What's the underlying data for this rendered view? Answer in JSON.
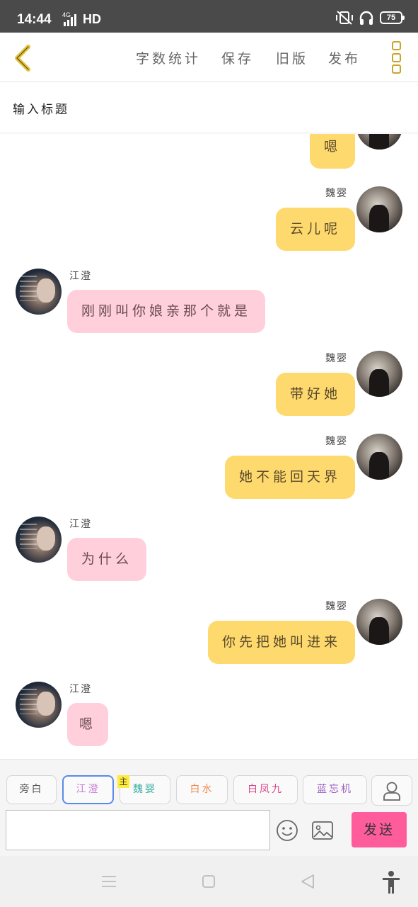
{
  "status": {
    "time": "14:44",
    "network": "4G",
    "hd": "HD",
    "battery": "75"
  },
  "toolbar": {
    "word_count": "字数统计",
    "save": "保存",
    "old_version": "旧版",
    "publish": "发布"
  },
  "title_field": {
    "placeholder": "输入标题"
  },
  "messages": [
    {
      "side": "right",
      "speaker": "",
      "text": "嗯",
      "color": "yellow"
    },
    {
      "side": "right",
      "speaker": "魏婴",
      "text": "云儿呢",
      "color": "yellow"
    },
    {
      "side": "left",
      "speaker": "江澄",
      "text": "刚刚叫你娘亲那个就是",
      "color": "pink"
    },
    {
      "side": "right",
      "speaker": "魏婴",
      "text": "带好她",
      "color": "yellow"
    },
    {
      "side": "right",
      "speaker": "魏婴",
      "text": "她不能回天界",
      "color": "yellow"
    },
    {
      "side": "left",
      "speaker": "江澄",
      "text": "为什么",
      "color": "pink"
    },
    {
      "side": "right",
      "speaker": "魏婴",
      "text": "你先把她叫进来",
      "color": "yellow"
    },
    {
      "side": "left",
      "speaker": "江澄",
      "text": "嗯",
      "color": "pink"
    }
  ],
  "roles": [
    {
      "label": "旁白",
      "color": "#555555"
    },
    {
      "label": "江澄",
      "color": "#c77dd6"
    },
    {
      "label": "魏婴",
      "color": "#3ab0a0"
    },
    {
      "label": "白水",
      "color": "#f08a4b"
    },
    {
      "label": "白凤九",
      "color": "#d9488a"
    },
    {
      "label": "蓝忘机",
      "color": "#9b5fc0"
    }
  ],
  "main_tag": "主",
  "composer": {
    "message_value": "",
    "send_label": "发送"
  },
  "colors": {
    "accent_yellow": "#fed96e",
    "accent_pink": "#ffcfdb",
    "send_pink": "#ff5c9c",
    "back_arrow": "#e3c13a"
  }
}
